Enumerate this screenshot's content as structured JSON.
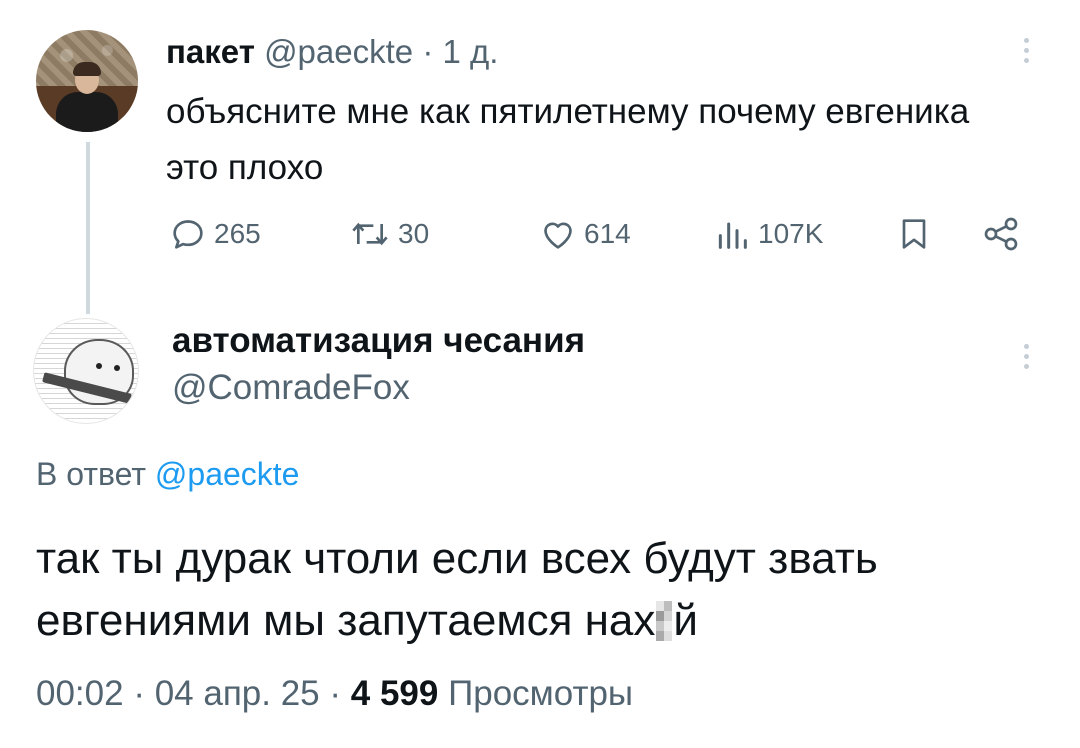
{
  "tweet1": {
    "name": "пакет",
    "handle": "@paeckte",
    "separator": "·",
    "time": "1 д.",
    "text": "объясните мне как пятилетнему почему евгеника это плохо",
    "actions": {
      "replies": "265",
      "retweets": "30",
      "likes": "614",
      "views": "107K"
    },
    "icons": [
      "reply-icon",
      "retweet-icon",
      "like-icon",
      "views-icon",
      "bookmark-icon",
      "share-icon",
      "more-icon"
    ]
  },
  "tweet2": {
    "name": "автоматизация чесания",
    "handle": "@ComradeFox",
    "reply_prefix": "В ответ",
    "reply_to": "@paeckte",
    "text_part1": "так ты дурак чтоли если всех будут звать евгениями мы запутаемся нах",
    "text_part2": "й",
    "time": "00:02",
    "separator": "·",
    "date": "04 апр. 25",
    "views_count": "4 599",
    "views_label": "Просмотры"
  },
  "colors": {
    "text": "#0f1419",
    "muted": "#536471",
    "link": "#1d9bf0",
    "thread_line": "#cfd9de"
  }
}
